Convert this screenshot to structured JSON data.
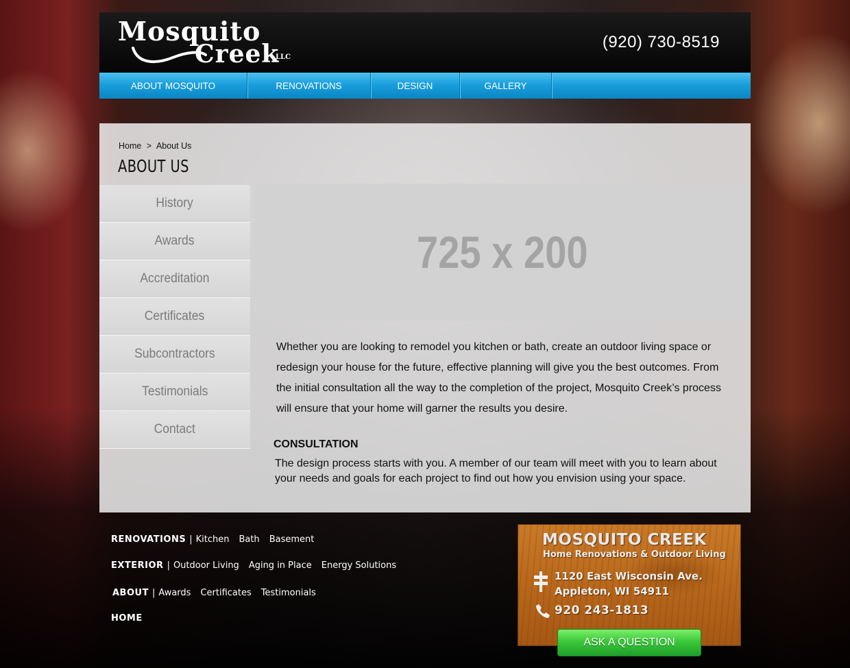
{
  "header": {
    "logo_line1": "Mosquito",
    "logo_line2": "Creek",
    "logo_suffix": "LLC",
    "phone": "(920) 730-8519"
  },
  "nav": {
    "items": [
      {
        "label": "ABOUT MOSQUITO"
      },
      {
        "label": "RENOVATIONS"
      },
      {
        "label": "DESIGN"
      },
      {
        "label": "GALLERY"
      }
    ]
  },
  "breadcrumb": {
    "home": "Home",
    "separator": ">",
    "current": "About Us"
  },
  "page": {
    "title": "ABOUT US",
    "placeholder": "725 x 200",
    "intro": "Whether you are looking to remodel you kitchen or bath, create an outdoor living space or redesign your house for the future, effective planning will give you the best outcomes. From the initial consultation all the way to the completion of the project, Mosquito Creek’s process will ensure that your home will garner the results you desire.",
    "section_title": "CONSULTATION",
    "section_body": "The design process starts with you. A member of our team will meet with you to learn about your needs and goals for each project to find out how you envision using your space."
  },
  "side_menu": {
    "items": [
      {
        "label": "History"
      },
      {
        "label": "Awards"
      },
      {
        "label": "Accreditation"
      },
      {
        "label": "Certificates"
      },
      {
        "label": "Subcontractors"
      },
      {
        "label": "Testimonials"
      },
      {
        "label": "Contact"
      }
    ]
  },
  "footer": {
    "separator": "|",
    "renovations": {
      "head": "RENOVATIONS",
      "links": [
        "Kitchen",
        "Bath",
        "Basement"
      ]
    },
    "exterior": {
      "head": "EXTERIOR",
      "links": [
        "Outdoor Living",
        "Aging in Place",
        "Energy Solutions"
      ]
    },
    "about": {
      "head": "ABOUT",
      "links": [
        "Awards",
        "Certificates",
        "Testimonials"
      ]
    },
    "home": {
      "head": "HOME"
    }
  },
  "contact_card": {
    "title": "MOSQUITO CREEK",
    "subtitle": "Home Renovations & Outdoor Living",
    "address_line1": "1120 East Wisconsin Ave.",
    "address_line2": "Appleton, WI 54911",
    "phone": "920 243-1813",
    "button": "ASK A QUESTION"
  },
  "colors": {
    "nav_blue": "#1a9fdc",
    "button_green": "#3cc83a",
    "wood": "#b8681c"
  }
}
